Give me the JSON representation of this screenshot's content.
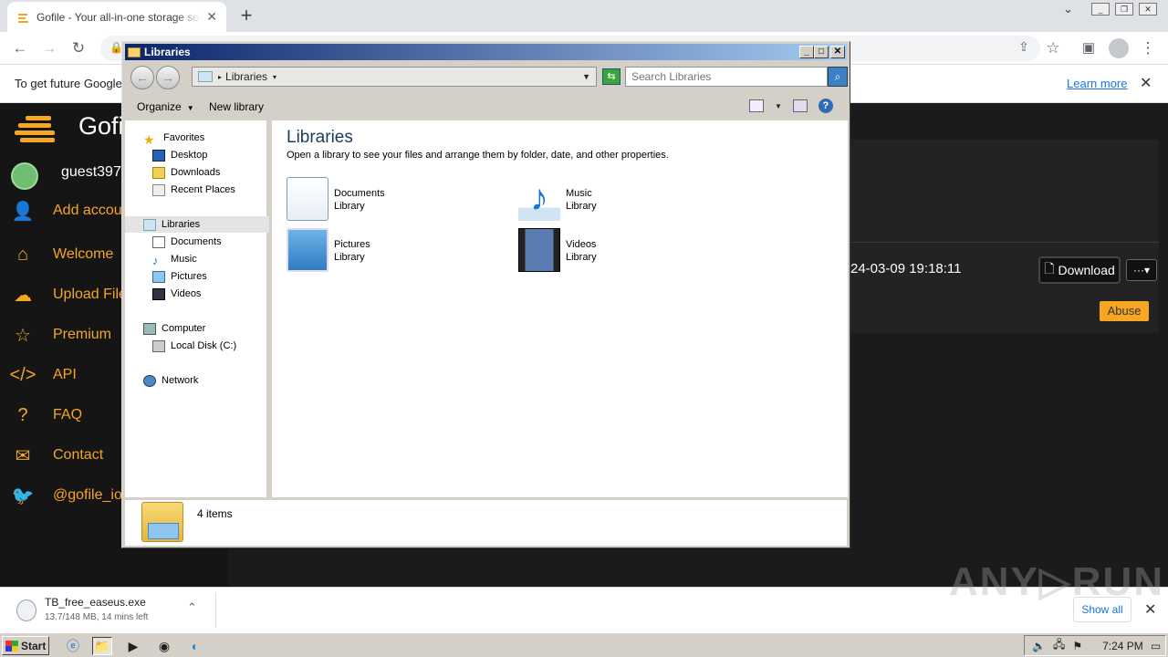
{
  "browser": {
    "tab_title": "Gofile - Your all-in-one storage soluti",
    "info_message": "To get future Google",
    "learn_more": "Learn more"
  },
  "site": {
    "brand": "Gofi",
    "user": "guest397",
    "nav": [
      {
        "label": "Add accou",
        "icon": "add-user-icon"
      },
      {
        "label": "Welcome",
        "icon": "home-icon"
      },
      {
        "label": "Upload File",
        "icon": "cloud-upload-icon"
      },
      {
        "label": "Premium",
        "icon": "star-icon"
      },
      {
        "label": "API",
        "icon": "code-icon"
      },
      {
        "label": "FAQ",
        "icon": "question-icon"
      },
      {
        "label": "Contact",
        "icon": "mail-icon"
      },
      {
        "label": "@gofile_io",
        "icon": "twitter-icon"
      }
    ],
    "file_date": "24-03-09 19:18:11",
    "download_label": "Download",
    "more_label": "···▾",
    "abuse_label": "Abuse",
    "accent_color": "#f5a623"
  },
  "explorer": {
    "title": "Libraries",
    "address": "Libraries",
    "search_placeholder": "Search Libraries",
    "organize": "Organize",
    "new_library": "New library",
    "nav_tree": {
      "favorites": "Favorites",
      "desktop": "Desktop",
      "downloads": "Downloads",
      "recent_places": "Recent Places",
      "libraries": "Libraries",
      "documents": "Documents",
      "music": "Music",
      "pictures": "Pictures",
      "videos": "Videos",
      "computer": "Computer",
      "local_disk": "Local Disk (C:)",
      "network": "Network"
    },
    "heading": "Libraries",
    "description": "Open a library to see your files and arrange them by folder, date, and other properties.",
    "libraries": [
      {
        "name": "Documents",
        "type": "Library"
      },
      {
        "name": "Music",
        "type": "Library"
      },
      {
        "name": "Pictures",
        "type": "Library"
      },
      {
        "name": "Videos",
        "type": "Library"
      }
    ],
    "item_count": "4 items"
  },
  "download_shelf": {
    "filename": "TB_free_easeus.exe",
    "status": "13.7/148 MB, 14 mins left",
    "show_all": "Show all"
  },
  "taskbar": {
    "start": "Start",
    "clock": "7:24 PM"
  }
}
